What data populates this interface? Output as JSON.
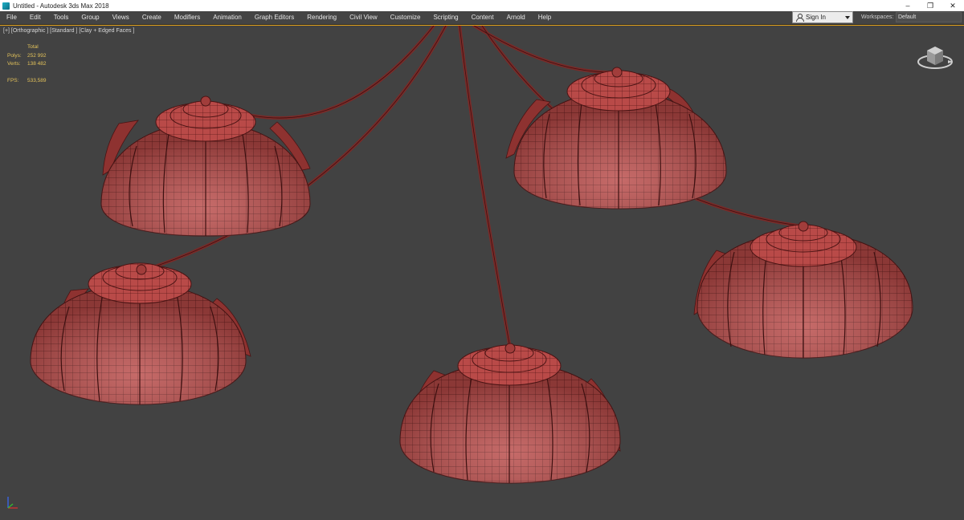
{
  "window": {
    "title": "Untitled - Autodesk 3ds Max 2018",
    "controls": {
      "minimize": "–",
      "restore": "❐",
      "close": "✕"
    }
  },
  "menu": {
    "items": [
      "File",
      "Edit",
      "Tools",
      "Group",
      "Views",
      "Create",
      "Modifiers",
      "Animation",
      "Graph Editors",
      "Rendering",
      "Civil View",
      "Customize",
      "Scripting",
      "Content",
      "Arnold",
      "Help"
    ]
  },
  "account": {
    "signin_label": "Sign In"
  },
  "workspace": {
    "label": "Workspaces:",
    "value": "Default"
  },
  "viewport": {
    "label": "[+] [Orthographic ] [Standard ] [Clay + Edged Faces ]",
    "stats": {
      "header": "Total",
      "polys_label": "Polys:",
      "polys_value": "252 992",
      "verts_label": "Verts:",
      "verts_value": "138 482",
      "fps_label": "FPS:",
      "fps_value": "533,589"
    },
    "colors": {
      "clay": "#b94a48",
      "wire": "#5a1818",
      "background": "#424242",
      "active_border": "#e0a019"
    }
  }
}
